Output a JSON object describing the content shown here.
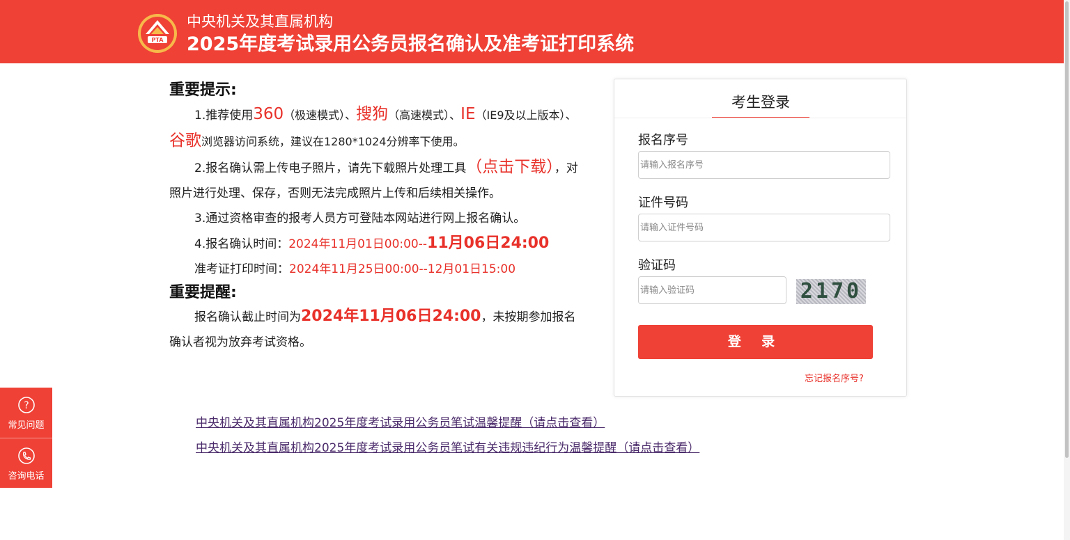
{
  "header": {
    "subtitle": "中央机关及其直属机构",
    "title": "2025年度考试录用公务员报名确认及准考证打印系统",
    "logo_text": "PTA"
  },
  "notice": {
    "heading1": "重要提示:",
    "item1": {
      "a": "1.推荐使用",
      "b": "360",
      "c": "（极速模式）、",
      "d": "搜狗",
      "e": "（高速模式）、",
      "f": "IE",
      "g": "（IE9及以上版本）、",
      "h": "谷歌",
      "i": "浏览器访问系统，建议在1280*1024分辨率下使用。"
    },
    "item2": {
      "a": "2.报名确认需上传电子照片，请先下载照片处理工具",
      "b": "（点击下载）",
      "c": "，对照片进行处理、保存，否则无法完成照片上传和后续相关操作。"
    },
    "item3": "3.通过资格审查的报考人员方可登陆本网站进行网上报名确认。",
    "item4": {
      "a": "4.报名确认时间：",
      "b": "2024年11月01日00:00--",
      "c": "11月06日24:00"
    },
    "item5": {
      "a": "准考证打印时间：",
      "b": "2024年11月25日00:00--12月01日15:00"
    },
    "heading2": "重要提醒:",
    "reminder": {
      "a": "报名确认截止时间为",
      "b": "2024年11月06日24:00",
      "c": "，未按期参加报名确认者视为放弃考试资格。"
    }
  },
  "login": {
    "tab": "考生登录",
    "reg_label": "报名序号",
    "reg_placeholder": "请输入报名序号",
    "id_label": "证件号码",
    "id_placeholder": "请输入证件号码",
    "captcha_label": "验证码",
    "captcha_placeholder": "请输入验证码",
    "captcha_text": "2170",
    "button": "登 录",
    "forgot": "忘记报名序号?"
  },
  "links": [
    "中央机关及其直属机构2025年度考试录用公务员笔试温馨提醒（请点击查看）",
    "中央机关及其直属机构2025年度考试录用公务员笔试有关违规违纪行为温馨提醒（请点击查看）"
  ],
  "side": {
    "faq": "常见问题",
    "phone": "咨询电话"
  },
  "colors": {
    "brand_red": "#ef4136",
    "link_purple": "#4a2a6a"
  }
}
